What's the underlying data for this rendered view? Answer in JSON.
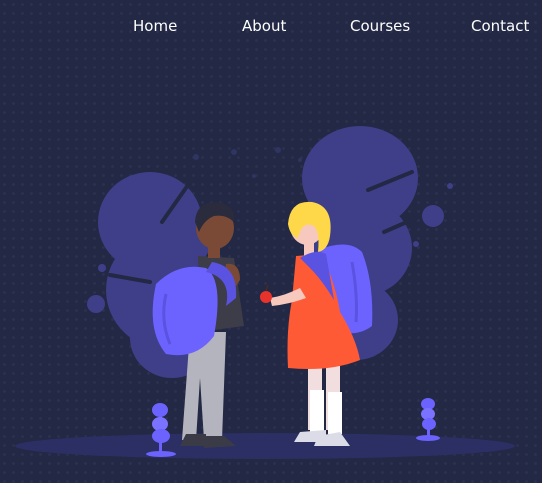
{
  "nav": {
    "items": [
      {
        "label": "Home"
      },
      {
        "label": "About"
      },
      {
        "label": "Courses"
      },
      {
        "label": "Contact"
      }
    ]
  },
  "hero": {
    "illustration": "two-children-with-backpacks",
    "icons": [
      "tree-left",
      "tree-right",
      "bush-icon",
      "bush-icon"
    ]
  },
  "colors": {
    "background": "#232844",
    "nav_text": "#ffffff",
    "tree": "#3e3f88",
    "backpack": "#6c63ff",
    "dress": "#ff5a36",
    "hair": "#ffd84a"
  }
}
